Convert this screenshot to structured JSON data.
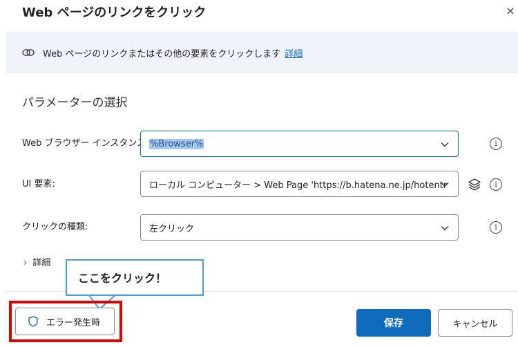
{
  "dialog": {
    "title": "Web ページのリンクをクリック",
    "close_icon": "×"
  },
  "info_banner": {
    "icon": "link-icon",
    "text": "Web ページのリンクまたはその他の要素をクリックします",
    "link_label": "詳細"
  },
  "parameters": {
    "section_title": "パラメーターの選択",
    "browser_instance": {
      "label": "Web ブラウザー インスタンス:",
      "value": "%Browser%"
    },
    "ui_element": {
      "label": "UI 要素:",
      "value": "ローカル コンピューター > Web Page 'https://b.hatena.ne.jp/hotentr"
    },
    "click_type": {
      "label": "クリックの種類:",
      "value": "左クリック"
    },
    "details_toggle": "詳細"
  },
  "annotation": {
    "callout_text": "ここをクリック！",
    "highlight_color": "#e30000",
    "callout_border_color": "#4aa0d8"
  },
  "footer": {
    "on_error_label": "エラー発生時",
    "save_label": "保存",
    "cancel_label": "キャンセル"
  },
  "colors": {
    "accent": "#0f6cbd",
    "banner_bg": "#eff4fb",
    "selection_bg": "#a8c7ee"
  }
}
